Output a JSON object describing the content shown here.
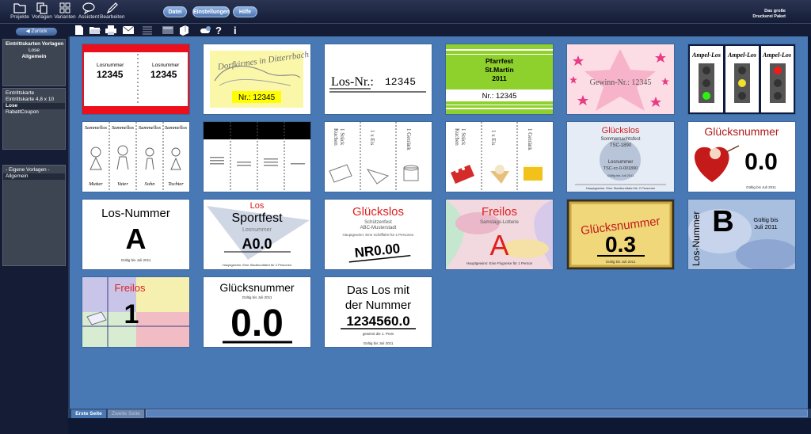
{
  "toolbar": {
    "buttons": [
      {
        "name": "projects-button",
        "icon": "folder-icon",
        "label": "Projekte"
      },
      {
        "name": "templates-button",
        "icon": "documents-icon",
        "label": "Vorlagen"
      },
      {
        "name": "variants-button",
        "icon": "grid-icon",
        "label": "Varianten"
      },
      {
        "name": "assistant-button",
        "icon": "speech-bubble-icon",
        "label": "Assistent"
      },
      {
        "name": "edit-button",
        "icon": "pencil-icon",
        "label": "Bearbeiten"
      }
    ],
    "menu": {
      "file": "Datei",
      "settings": "Einstellungen",
      "help": "Hilfe"
    },
    "brand": {
      "line1": "Das große",
      "line2": "Druckerei Paket"
    }
  },
  "sidebar": {
    "back": "Zurück",
    "nav": {
      "title": "Eintrittskarten Vorlagen",
      "sub": "Lose",
      "current": "Allgemein"
    },
    "categories": [
      "Eintrittskarte",
      "Eintrittskarte 4,8 x 10",
      "Lose",
      "RabattCoupon"
    ],
    "selected_category": "Lose",
    "own": {
      "title": "- Eigene Vorlagen -",
      "items": [
        "Allgemein"
      ]
    }
  },
  "icons": [
    "new-document-icon",
    "open-folder-icon",
    "printer-icon",
    "email-icon",
    "list-icon",
    "image-icon",
    "3d-box-icon",
    "toggle-icon",
    "help-icon",
    "info-icon"
  ],
  "templates": {
    "t1": {
      "num_label": "Losnummer",
      "num": "12345"
    },
    "t2": {
      "title": "Dorfkirmes in Ditterrbach",
      "num": "Nr.: 12345"
    },
    "t3": {
      "label": "Los-Nr.:",
      "num": "12345"
    },
    "t4": {
      "line1": "Pfarrfest",
      "line2": "St.Martin",
      "year": "2011",
      "num": "Nr.: 12345"
    },
    "t5": {
      "text": "Gewinn-Nr.: 12345"
    },
    "t6": {
      "label": "Ampel-Los"
    },
    "t7": {
      "head": "Sammellos",
      "names": [
        "Mutter",
        "Vater",
        "Sohn",
        "Tochter"
      ]
    },
    "t9": {
      "stueck": "1 Stück",
      "kuchen": "Kuchen",
      "eis": "1 x Eis",
      "getraenk": "1 Getränk"
    },
    "t11": {
      "title": "Glückslos",
      "sub": "Sommernachtsfest",
      "club": "TSC-1890",
      "label": "Losnummer",
      "num": "TSC-cc-0-001890",
      "valid": "Gültig bis Juli 2011",
      "prize": "Hauptgewinn: Eine Stadtrundfahrt für 2 Personen"
    },
    "t12": {
      "title": "Glücksnummer",
      "num": "0.0",
      "valid": "Gültig bis Juli 2011"
    },
    "t13": {
      "title": "Los-Nummer",
      "letter": "A",
      "valid": "Gültig bis Juli 2011"
    },
    "t14": {
      "los": "Los",
      "title": "Sportfest",
      "label": "Losnummer",
      "num": "A0.0",
      "prize": "Hauptgewinn: Eine Stadtrundfahrt für 2 Personen"
    },
    "t15": {
      "title": "Glückslos",
      "sub": "Schützenfest",
      "place": "ABC-Musterstadt",
      "prize": "Hauptgewinn: Eine Schifffahrt für 2 Personen",
      "num": "NR0.00"
    },
    "t16": {
      "title": "Freilos",
      "sub": "Samstags-Lotterie",
      "letter": "A",
      "prize": "Hauptgewinn: Eine Flugreise für 1 Person"
    },
    "t17": {
      "title": "Glücksnummer",
      "num": "0.3",
      "valid": "Gültig bis Juli 2011"
    },
    "t18": {
      "letter": "B",
      "label": "Los-Nummer",
      "valid_line1": "Gültig bis",
      "valid_line2": "Juli 2011"
    },
    "t19": {
      "title": "Freilos",
      "num": "1"
    },
    "t20": {
      "title": "Glücksnummer",
      "valid": "Gültig bis Juli 2011",
      "num": "0.0"
    },
    "t21": {
      "line1": "Das Los mit",
      "line2": "der Nummer",
      "num": "1234560.0",
      "note": "gewinnt die 1. Preis",
      "valid": "Gültig bis Juli 2011"
    }
  },
  "footer": {
    "tabs": [
      "Erste Seite",
      "Zweite Seite"
    ],
    "active": "Erste Seite"
  }
}
